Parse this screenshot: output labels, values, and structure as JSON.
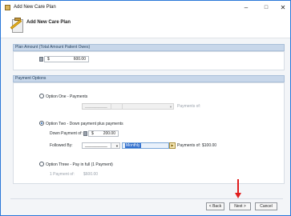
{
  "window": {
    "title": "Add New Care Plan",
    "controls": {
      "minimize": "–",
      "maximize": "□",
      "close": "✕"
    }
  },
  "header": {
    "title": "Add New Care Plan"
  },
  "plan_amount": {
    "section_title": "Plan Amount (Total Amount Patient Owes)",
    "currency": "$",
    "value": "600.00"
  },
  "payment_options": {
    "section_title": "Payment Options",
    "option_one": {
      "label": "Option One - Payments",
      "amount_placeholder": "__________",
      "payments_of_label": "Payments of:"
    },
    "option_two": {
      "label": "Option Two - Down payment plus payments",
      "down_payment_label": "Down Payment of:",
      "down_payment_currency": "$",
      "down_payment_value": "200.00",
      "followed_by_label": "Followed By:",
      "followed_by_value": "__________",
      "frequency_value": "Monthly",
      "payments_of_label": "Payments of:",
      "payments_of_value": "$100.00"
    },
    "option_three": {
      "label": "Option Three - Pay in full (1 Payment)",
      "payment_of_label": "1 Payment of:",
      "payment_of_value": "$600.00"
    }
  },
  "footer": {
    "back_label": "< Back",
    "next_label": "Next >",
    "cancel_label": "Cancel"
  },
  "annotation": {
    "color": "#e11d1d"
  }
}
